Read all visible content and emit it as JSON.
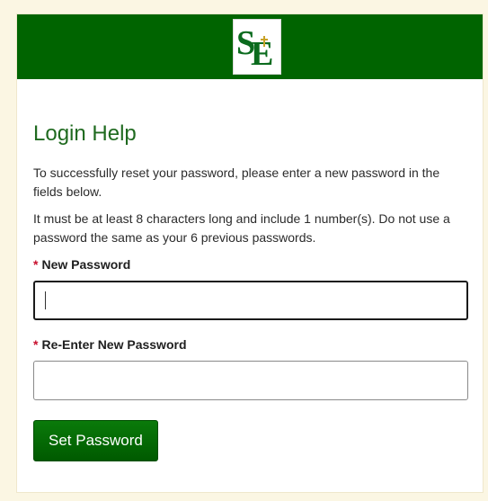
{
  "header": {
    "logo_icon": "school-monogram-se-logo",
    "logo_letters": "SE",
    "banner_color": "#006400"
  },
  "page": {
    "title": "Login Help",
    "instructions_1": "To successfully reset your password, please enter a new password in the fields below.",
    "instructions_2": "It must be at least 8 characters long and include 1 number(s). Do not use a password the same as your 6 previous passwords."
  },
  "form": {
    "required_marker": "*",
    "new_password": {
      "label": "New Password",
      "value": ""
    },
    "confirm_password": {
      "label": "Re-Enter New Password",
      "value": ""
    },
    "submit_label": "Set Password"
  },
  "colors": {
    "accent_green": "#1f6a1f",
    "required_red": "#c8102e",
    "page_background": "#fbf6e3"
  }
}
